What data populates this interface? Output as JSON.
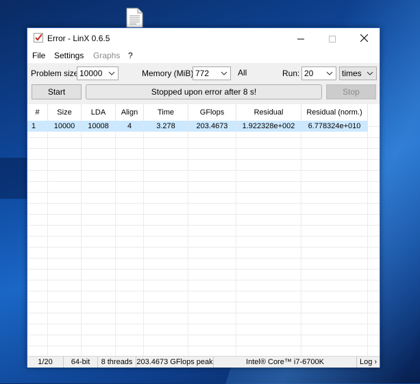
{
  "window": {
    "title": "Error - LinX 0.6.5"
  },
  "menu": {
    "file": "File",
    "settings": "Settings",
    "graphs": "Graphs",
    "help": "?"
  },
  "toolbar": {
    "problem_size_label": "Problem size:",
    "problem_size_value": "10000",
    "memory_label": "Memory (MiB):",
    "memory_value": "772",
    "memory_all": "All",
    "run_label": "Run:",
    "run_value": "20",
    "run_unit": "times",
    "start_label": "Start",
    "status_text": "Stopped upon error after 8 s!",
    "stop_label": "Stop"
  },
  "table": {
    "headers": [
      "#",
      "Size",
      "LDA",
      "Align",
      "Time",
      "GFlops",
      "Residual",
      "Residual (norm.)"
    ],
    "rows": [
      [
        "1",
        "10000",
        "10008",
        "4",
        "3.278",
        "203.4673",
        "1.922328e+002",
        "6.778324e+010"
      ]
    ]
  },
  "statusbar": {
    "progress": "1/20",
    "bits": "64-bit",
    "threads": "8 threads",
    "peak": "203.4673 GFlops peak",
    "cpu": "Intel® Core™ i7-6700K",
    "log": "Log ›"
  }
}
